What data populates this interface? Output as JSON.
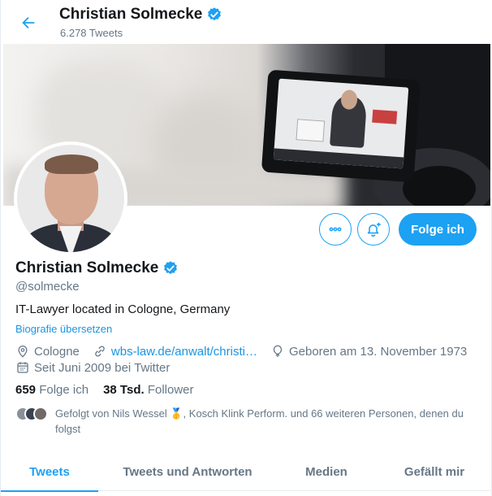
{
  "header": {
    "name": "Christian Solmecke",
    "tweet_count": "6.278 Tweets"
  },
  "profile": {
    "name": "Christian Solmecke",
    "handle": "@solmecke",
    "bio": "IT-Lawyer located in Cologne, Germany",
    "translate_label": "Biografie übersetzen",
    "location": "Cologne",
    "website": "wbs-law.de/anwalt/christi…",
    "birthday": "Geboren am 13. November 1973",
    "joined": "Seit Juni 2009 bei Twitter",
    "following_count": "659",
    "following_label": "Folge ich",
    "followers_count": "38 Tsd.",
    "followers_label": "Follower",
    "followed_by": "Gefolgt von Nils Wessel 🥇, Kosch Klink Perform. und 66 weiteren Personen, denen du folgst"
  },
  "actions": {
    "follow_label": "Folge ich"
  },
  "tabs": [
    {
      "label": "Tweets",
      "active": true
    },
    {
      "label": "Tweets und Antworten",
      "active": false
    },
    {
      "label": "Medien",
      "active": false
    },
    {
      "label": "Gefällt mir",
      "active": false
    }
  ],
  "colors": {
    "accent": "#1da1f2",
    "link": "#1b95e0",
    "secondary_text": "#657786"
  },
  "icons": {
    "back": "arrow-left-icon",
    "verified": "verified-badge-icon",
    "more": "more-icon",
    "notify": "bell-plus-icon",
    "location": "location-pin-icon",
    "link": "link-icon",
    "birthday": "balloon-icon",
    "joined": "calendar-icon"
  }
}
